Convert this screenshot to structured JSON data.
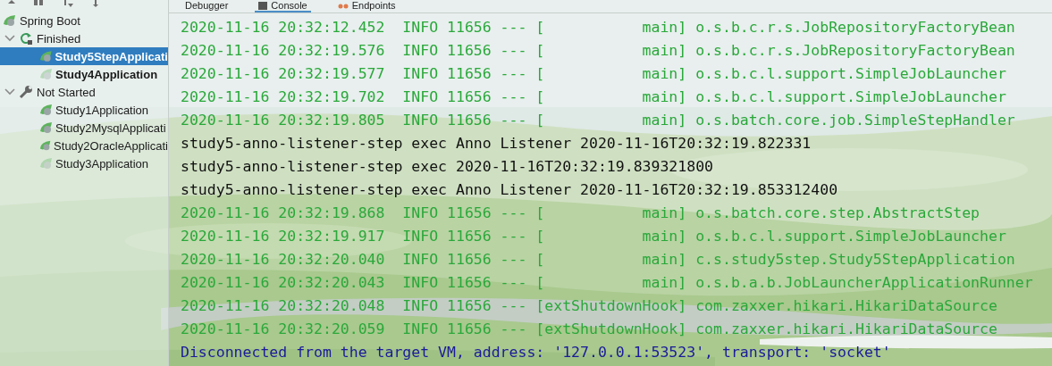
{
  "tabs": [
    {
      "label": "Debugger",
      "kind": "plain",
      "selected": false
    },
    {
      "label": "Console",
      "kind": "console",
      "selected": true
    },
    {
      "label": "Endpoints",
      "kind": "endpoints",
      "selected": false
    }
  ],
  "tree": [
    {
      "label": "Spring Boot",
      "kind": "spring",
      "children": [
        {
          "label": "Finished",
          "kind": "finished",
          "expanded": true,
          "children": [
            {
              "label": "Study5StepApplicati",
              "selected": true,
              "bold": true,
              "dimmed": false
            },
            {
              "label": "Study4Application",
              "selected": false,
              "bold": true,
              "dimmed": true
            }
          ]
        },
        {
          "label": "Not Started",
          "kind": "notstarted",
          "expanded": true,
          "children": [
            {
              "label": "Study1Application",
              "selected": false,
              "bold": false,
              "dimmed": false
            },
            {
              "label": "Study2MysqlApplicati",
              "selected": false,
              "bold": false,
              "dimmed": false
            },
            {
              "label": "Study2OracleApplicati",
              "selected": false,
              "bold": false,
              "dimmed": false
            },
            {
              "label": "Study3Application",
              "selected": false,
              "bold": false,
              "dimmed": true
            }
          ]
        }
      ]
    }
  ],
  "console": [
    {
      "kind": "log",
      "text": "2020-11-16 20:32:12.452  INFO 11656 --- [           main] o.s.b.c.r.s.JobRepositoryFactoryBean"
    },
    {
      "kind": "log",
      "text": "2020-11-16 20:32:19.576  INFO 11656 --- [           main] o.s.b.c.r.s.JobRepositoryFactoryBean"
    },
    {
      "kind": "log",
      "text": "2020-11-16 20:32:19.577  INFO 11656 --- [           main] o.s.b.c.l.support.SimpleJobLauncher"
    },
    {
      "kind": "log",
      "text": "2020-11-16 20:32:19.702  INFO 11656 --- [           main] o.s.b.c.l.support.SimpleJobLauncher"
    },
    {
      "kind": "log",
      "text": "2020-11-16 20:32:19.805  INFO 11656 --- [           main] o.s.batch.core.job.SimpleStepHandler"
    },
    {
      "kind": "out",
      "text": "study5-anno-listener-step exec Anno Listener 2020-11-16T20:32:19.822331"
    },
    {
      "kind": "out",
      "text": "study5-anno-listener-step exec 2020-11-16T20:32:19.839321800"
    },
    {
      "kind": "out",
      "text": "study5-anno-listener-step exec Anno Listener 2020-11-16T20:32:19.853312400"
    },
    {
      "kind": "log",
      "text": "2020-11-16 20:32:19.868  INFO 11656 --- [           main] o.s.batch.core.step.AbstractStep"
    },
    {
      "kind": "log",
      "text": "2020-11-16 20:32:19.917  INFO 11656 --- [           main] o.s.b.c.l.support.SimpleJobLauncher"
    },
    {
      "kind": "log",
      "text": "2020-11-16 20:32:20.040  INFO 11656 --- [           main] c.s.study5step.Study5StepApplication"
    },
    {
      "kind": "log",
      "text": "2020-11-16 20:32:20.043  INFO 11656 --- [           main] o.s.b.a.b.JobLauncherApplicationRunner"
    },
    {
      "kind": "log",
      "text": "2020-11-16 20:32:20.048  INFO 11656 --- [extShutdownHook] com.zaxxer.hikari.HikariDataSource"
    },
    {
      "kind": "log",
      "text": "2020-11-16 20:32:20.059  INFO 11656 --- [extShutdownHook] com.zaxxer.hikari.HikariDataSource"
    },
    {
      "kind": "system",
      "text": "Disconnected from the target VM, address: '127.0.0.1:53523', transport: 'socket'"
    }
  ]
}
